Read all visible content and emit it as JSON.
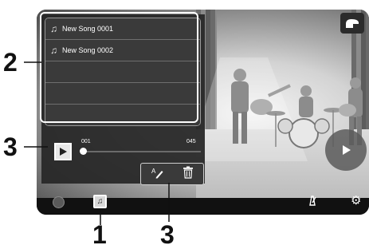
{
  "songs": [
    {
      "label": "New Song 0001",
      "icon": "note-icon"
    },
    {
      "label": "New Song 0002",
      "icon": "note-icon"
    }
  ],
  "position": {
    "start": "001",
    "end": "045",
    "fraction": 0.0
  },
  "callouts": {
    "list": "2",
    "play": "3",
    "tools": "3",
    "song_button": "1"
  },
  "icons": {
    "note": "♫",
    "edit": "rename-icon",
    "delete": "trash-icon",
    "play": "play-icon",
    "piano": "piano-icon",
    "metronome": "metronome-icon",
    "settings": "gear-icon"
  },
  "colors": {
    "panel": "#282828",
    "highlight": "#ffffff",
    "stage": "#d3d3d3"
  }
}
